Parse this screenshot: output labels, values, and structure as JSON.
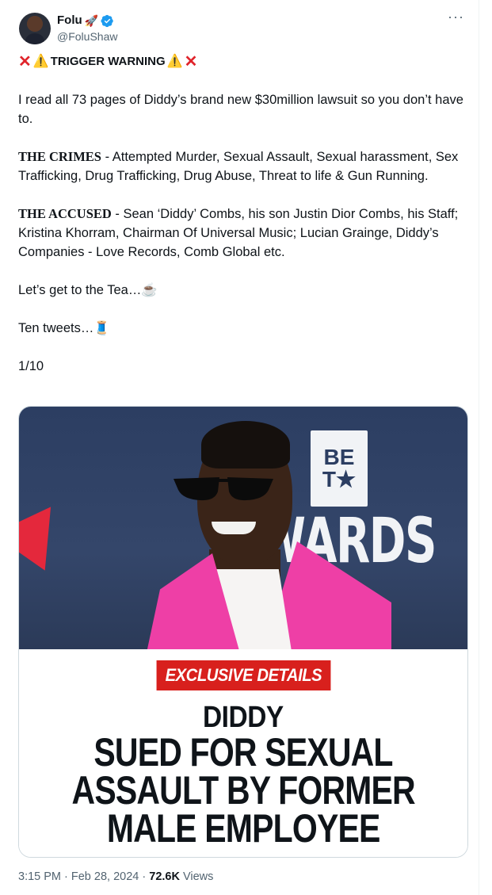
{
  "author": {
    "display_name": "Folu",
    "name_emoji": "🚀",
    "handle": "@FoluShaw",
    "verified": true
  },
  "tweet": {
    "trigger_warning": "TRIGGER WARNING",
    "intro": "I read all 73 pages of Diddy’s brand new $30million lawsuit so you don’t have to.",
    "crimes_label": "THE CRIMES",
    "crimes_text": " - Attempted Murder, Sexual Assault, Sexual harassment, Sex Trafficking, Drug Trafficking, Drug Abuse, Threat to life & Gun Running.",
    "accused_label": "THE ACCUSED",
    "accused_text": " - Sean ‘Diddy’ Combs, his son Justin Dior Combs, his Staff; Kristina Khorram, Chairman Of Universal Music; Lucian Grainge, Diddy’s Companies - Love Records, Comb Global etc.",
    "tea_line": "Let’s get to the Tea…",
    "tea_emoji": "☕",
    "thread_line": "Ten tweets…",
    "thread_emoji": "🧵",
    "counter": "1/10"
  },
  "media": {
    "bet_logo_lines": [
      "BE",
      "T★"
    ],
    "backdrop_text": "WARDS",
    "exclusive_label": "EXCLUSIVE DETAILS",
    "headline_lines": [
      "DIDDY",
      "SUED FOR SEXUAL",
      "ASSAULT BY FORMER",
      "MALE EMPLOYEE"
    ]
  },
  "meta": {
    "time": "3:15 PM",
    "date": "Feb 28, 2024",
    "views_count": "72.6K",
    "views_label": "Views",
    "separator": " · "
  },
  "colors": {
    "verified_blue": "#1d9bf0",
    "jacket_pink": "#ee3fa6",
    "exclusive_red": "#d8201d"
  }
}
